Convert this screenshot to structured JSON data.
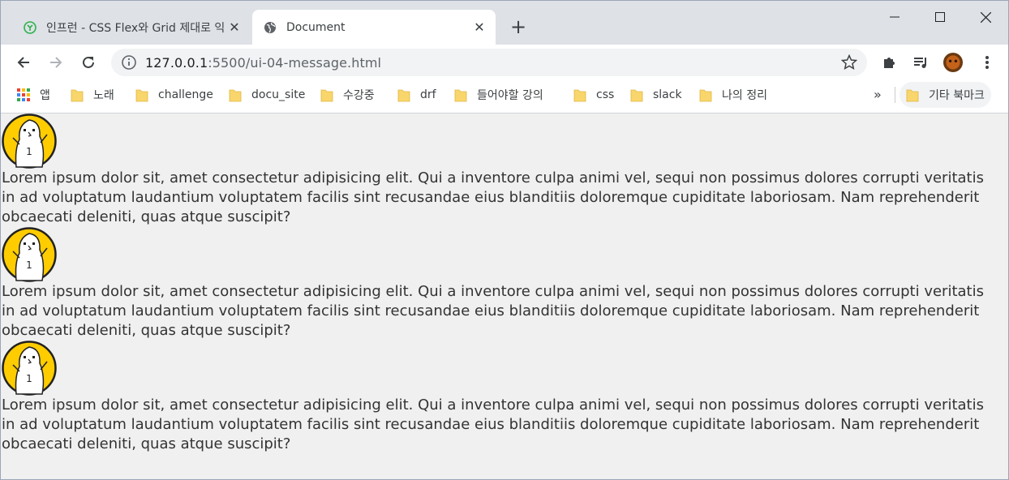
{
  "tabs": [
    {
      "title": "인프런 - CSS Flex와 Grid 제대로 익히기",
      "active": false
    },
    {
      "title": "Document",
      "active": true
    }
  ],
  "url": {
    "host": "127.0.0.1",
    "path": ":5500/ui-04-message.html"
  },
  "bookmarks": {
    "apps_label": "앱",
    "items": [
      "노래",
      "challenge",
      "docu_site",
      "수강중",
      "drf",
      "들어야할 강의",
      "css",
      "slack",
      "나의 정리"
    ],
    "more": "»",
    "other": "기타 북마크"
  },
  "messages": [
    {
      "avatar": "cartoon-character-icon",
      "text": "Lorem ipsum dolor sit, amet consectetur adipisicing elit. Qui a inventore culpa animi vel, sequi non possimus dolores corrupti veritatis in ad voluptatum laudantium voluptatem facilis sint recusandae eius blanditiis doloremque cupiditate laboriosam. Nam reprehenderit obcaecati deleniti, quas atque suscipit?"
    },
    {
      "avatar": "cartoon-character-icon",
      "text": "Lorem ipsum dolor sit, amet consectetur adipisicing elit. Qui a inventore culpa animi vel, sequi non possimus dolores corrupti veritatis in ad voluptatum laudantium voluptatem facilis sint recusandae eius blanditiis doloremque cupiditate laboriosam. Nam reprehenderit obcaecati deleniti, quas atque suscipit?"
    },
    {
      "avatar": "cartoon-character-icon",
      "text": "Lorem ipsum dolor sit, amet consectetur adipisicing elit. Qui a inventore culpa animi vel, sequi non possimus dolores corrupti veritatis in ad voluptatum laudantium voluptatem facilis sint recusandae eius blanditiis doloremque cupiditate laboriosam. Nam reprehenderit obcaecati deleniti, quas atque suscipit?"
    }
  ],
  "colors": {
    "page_bg": "#f0f0f0",
    "tabstrip_bg": "#dee1e6",
    "avatar_yellow": "#ffcc00",
    "folder_yellow": "#f9d66c"
  }
}
